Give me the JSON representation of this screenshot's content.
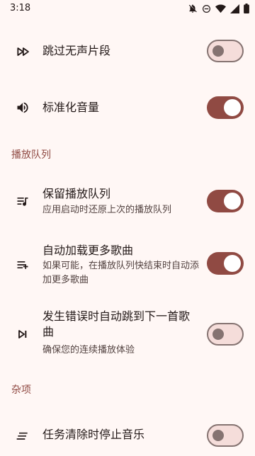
{
  "status_bar": {
    "time": "3:18",
    "icons": [
      "notifications-off-icon",
      "do-not-disturb-icon",
      "wifi-icon",
      "signal-icon",
      "battery-icon"
    ]
  },
  "colors": {
    "background": "#FFF7F5",
    "accent": "#904A43",
    "switch_off_track": "#F5DDDA",
    "switch_off_outline": "#857371",
    "text_primary": "#231918",
    "text_secondary": "#534341"
  },
  "settings": {
    "skip_silence": {
      "icon": "fast-forward-icon",
      "title": "跳过无声片段",
      "enabled": false
    },
    "normalize_volume": {
      "icon": "volume-icon",
      "title": "标准化音量",
      "enabled": true
    }
  },
  "sections": {
    "queue": {
      "header": "播放队列",
      "items": [
        {
          "icon": "queue-music-icon",
          "title": "保留播放队列",
          "subtitle": "应用启动时还原上次的播放队列",
          "enabled": true
        },
        {
          "icon": "playlist-add-icon",
          "title": "自动加载更多歌曲",
          "subtitle": "如果可能，在播放队列快结束时自动添加更多歌曲",
          "enabled": true
        },
        {
          "icon": "skip-next-icon",
          "title": "发生错误时自动跳到下一首歌曲",
          "subtitle": "确保您的连续播放体验",
          "enabled": false
        }
      ]
    },
    "misc": {
      "header": "杂项",
      "items": [
        {
          "icon": "clear-all-icon",
          "title": "任务清除时停止音乐",
          "enabled": false
        }
      ]
    }
  }
}
